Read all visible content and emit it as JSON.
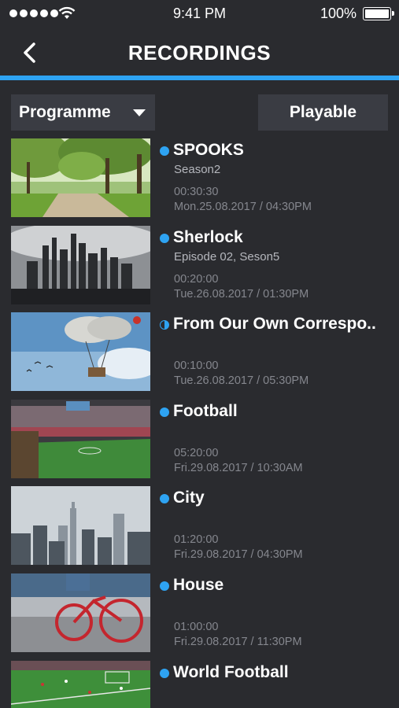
{
  "status_bar": {
    "time": "9:41 PM",
    "battery": "100%"
  },
  "header": {
    "title": "RECORDINGS"
  },
  "filters": {
    "sort_label": "Programme",
    "playable_label": "Playable"
  },
  "recordings": [
    {
      "title": "SPOOKS",
      "subtitle": "Season2",
      "duration": "00:30:30",
      "date": "Mon.25.08.2017 / 04:30PM",
      "status": "full",
      "thumbnail": "park-trees"
    },
    {
      "title": "Sherlock",
      "subtitle": "Episode 02, Seson5",
      "duration": "00:20:00",
      "date": "Tue.26.08.2017 / 01:30PM",
      "status": "full",
      "thumbnail": "city-skyline-dark"
    },
    {
      "title": "From Our Own Correspo..",
      "subtitle": "",
      "duration": "00:10:00",
      "date": "Tue.26.08.2017 / 05:30PM",
      "status": "partial",
      "thumbnail": "airship"
    },
    {
      "title": "Football",
      "subtitle": "",
      "duration": "05:20:00",
      "date": "Fri.29.08.2017 / 10:30AM",
      "status": "full",
      "thumbnail": "stadium"
    },
    {
      "title": "City",
      "subtitle": "",
      "duration": "01:20:00",
      "date": "Fri.29.08.2017 / 04:30PM",
      "status": "full",
      "thumbnail": "city-skyline"
    },
    {
      "title": "House",
      "subtitle": "",
      "duration": "01:00:00",
      "date": "Fri.29.08.2017 / 11:30PM",
      "status": "full",
      "thumbnail": "red-bicycle"
    },
    {
      "title": "World Football",
      "subtitle": "",
      "duration": "",
      "date": "",
      "status": "full",
      "thumbnail": "football-pitch"
    }
  ],
  "colors": {
    "accent": "#2ea3f2",
    "background": "#2a2b2f",
    "button": "#3a3c43"
  }
}
